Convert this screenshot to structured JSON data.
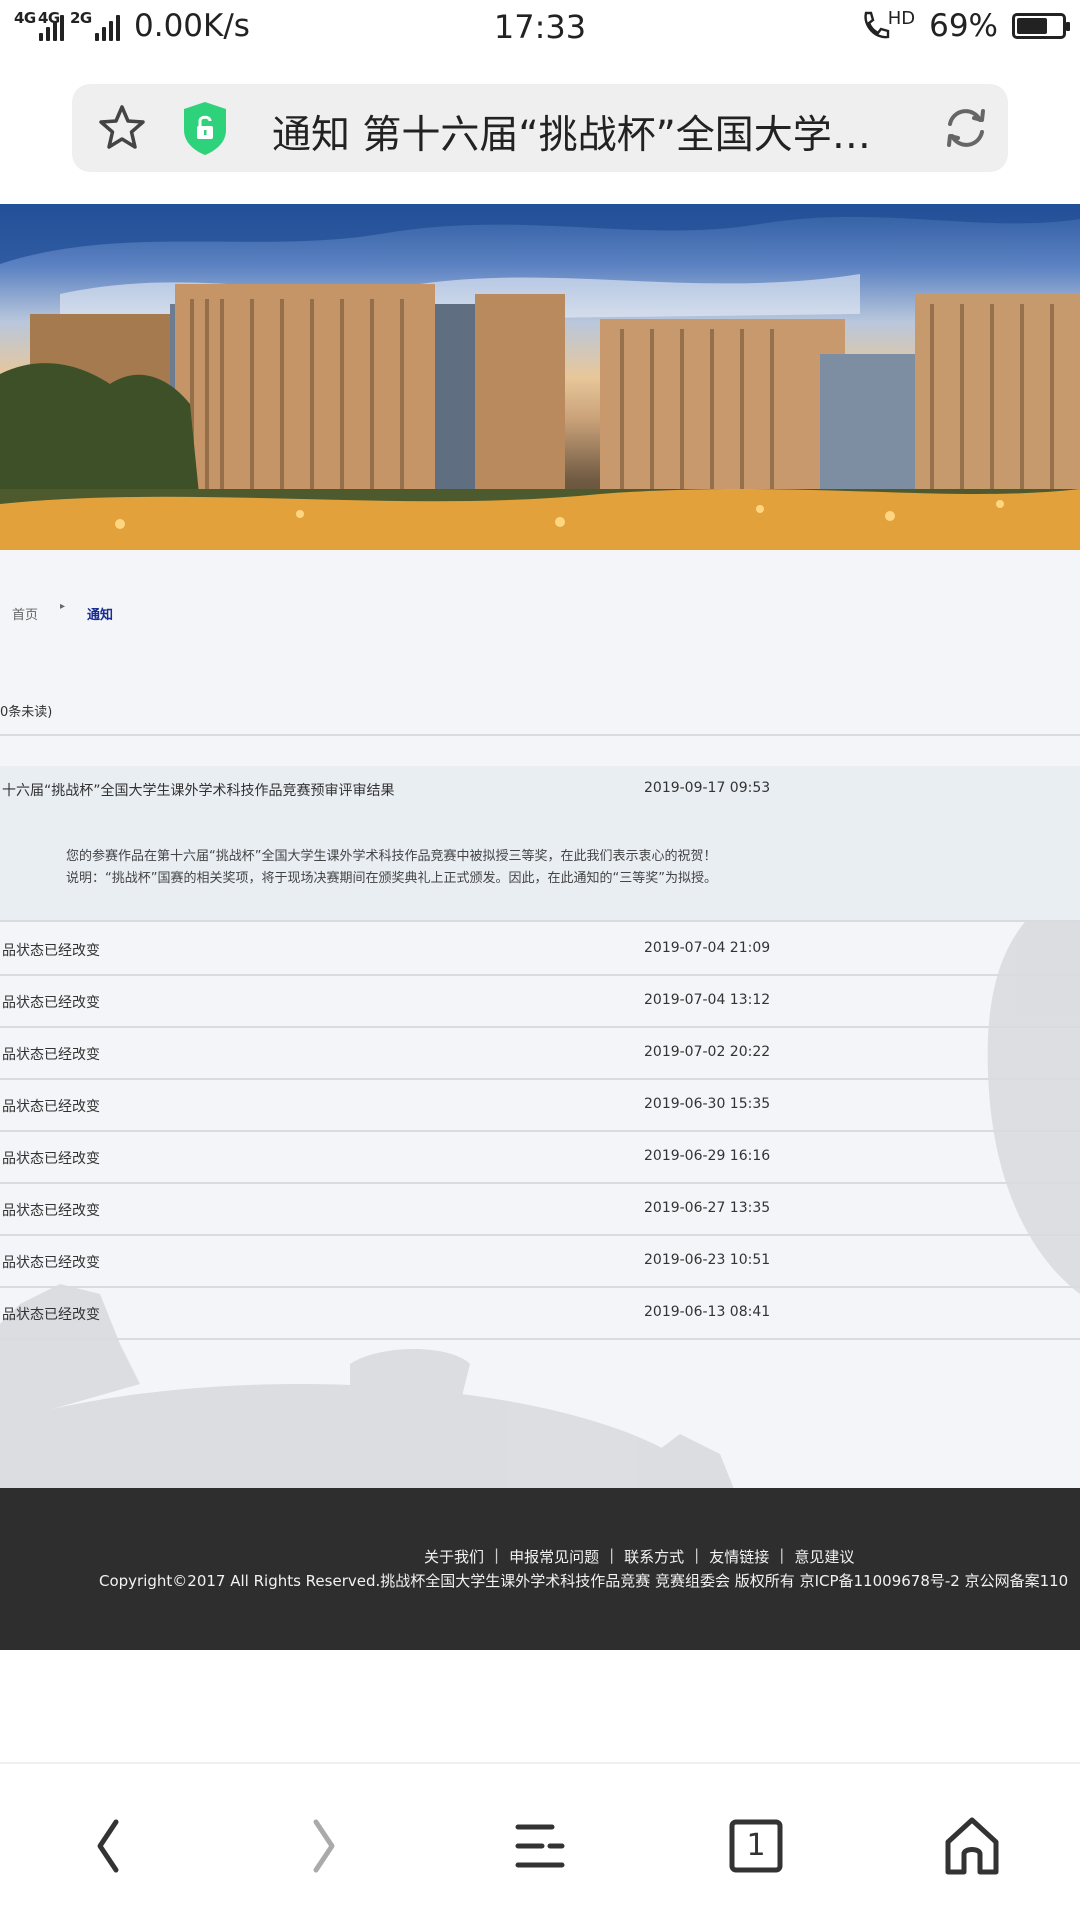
{
  "status_bar": {
    "signal_labels": [
      "4G",
      "4G",
      "2G"
    ],
    "net_speed": "0.00K/s",
    "time": "17:33",
    "hd_label": "HD",
    "battery_percent_text": "69%",
    "battery_level": 0.69
  },
  "browser": {
    "page_title": "通知 第十六届“挑战杯”全国大学生课外学术科技作品竞赛",
    "icons": [
      "star-icon",
      "shield-lock-icon",
      "reload-icon"
    ]
  },
  "breadcrumb": {
    "home": "首页",
    "current": "通知"
  },
  "unread_label": "0条未读)",
  "notices": {
    "expanded": {
      "title": "十六届“挑战杯”全国大学生课外学术科技作品竞赛预审评审结果",
      "date": "2019-09-17 09:53",
      "detail_line1": "您的参赛作品在第十六届“挑战杯”全国大学生课外学术科技作品竞赛中被拟授三等奖，在此我们表示衷心的祝贺！",
      "detail_line2": "说明：“挑战杯”国赛的相关奖项，将于现场决赛期间在颁奖典礼上正式颁发。因此，在此通知的“三等奖”为拟授。"
    },
    "items": [
      {
        "title": "品状态已经改变",
        "date": "2019-07-04 21:09"
      },
      {
        "title": "品状态已经改变",
        "date": "2019-07-04 13:12"
      },
      {
        "title": "品状态已经改变",
        "date": "2019-07-02 20:22"
      },
      {
        "title": "品状态已经改变",
        "date": "2019-06-30 15:35"
      },
      {
        "title": "品状态已经改变",
        "date": "2019-06-29 16:16"
      },
      {
        "title": "品状态已经改变",
        "date": "2019-06-27 13:35"
      },
      {
        "title": "品状态已经改变",
        "date": "2019-06-23 10:51"
      },
      {
        "title": "品状态已经改变",
        "date": "2019-06-13 08:41"
      }
    ]
  },
  "footer": {
    "links": [
      "关于我们",
      "申报常见问题",
      "联系方式",
      "友情链接",
      "意见建议"
    ],
    "separator": "|",
    "copyright": "Copyright©2017 All Rights Reserved.挑战杯全国大学生课外学术科技作品竞赛 竞赛组委会 版权所有 京ICP备11009678号-2 京公网备案110"
  },
  "bottom_nav": {
    "tab_count": "1",
    "icons": [
      "back-icon",
      "forward-icon",
      "menu-icon",
      "tabs-icon",
      "home-icon"
    ]
  },
  "colors": {
    "breadcrumb_current": "#1a2d8f",
    "footer_bg": "#2e2e2e",
    "shield": "#2ed27a"
  }
}
